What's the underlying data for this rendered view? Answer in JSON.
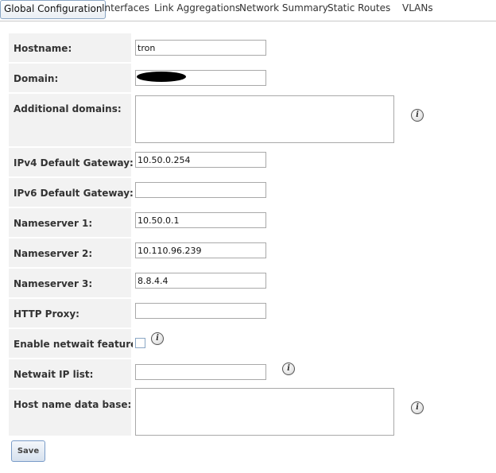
{
  "tabs": [
    {
      "label": "Global Configuration",
      "active": true
    },
    {
      "label": "Interfaces",
      "active": false
    },
    {
      "label": "Link Aggregations",
      "active": false
    },
    {
      "label": "Network Summary",
      "active": false
    },
    {
      "label": "Static Routes",
      "active": false
    },
    {
      "label": "VLANs",
      "active": false
    }
  ],
  "form": {
    "hostname": {
      "label": "Hostname:",
      "value": "tron"
    },
    "domain": {
      "label": "Domain:",
      "value": ""
    },
    "additional_domains": {
      "label": "Additional domains:",
      "value": ""
    },
    "ipv4_gateway": {
      "label": "IPv4 Default Gateway:",
      "value": "10.50.0.254"
    },
    "ipv6_gateway": {
      "label": "IPv6 Default Gateway:",
      "value": ""
    },
    "nameserver1": {
      "label": "Nameserver 1:",
      "value": "10.50.0.1"
    },
    "nameserver2": {
      "label": "Nameserver 2:",
      "value": "10.110.96.239"
    },
    "nameserver3": {
      "label": "Nameserver 3:",
      "value": "8.8.4.4"
    },
    "http_proxy": {
      "label": "HTTP Proxy:",
      "value": ""
    },
    "netwait": {
      "label": "Enable netwait feature:",
      "checked": false
    },
    "netwait_ip": {
      "label": "Netwait IP list:",
      "value": ""
    },
    "host_db": {
      "label": "Host name data base:",
      "value": ""
    }
  },
  "icons": {
    "info": "info-icon",
    "info_glyph": "i"
  },
  "save_label": "Save"
}
